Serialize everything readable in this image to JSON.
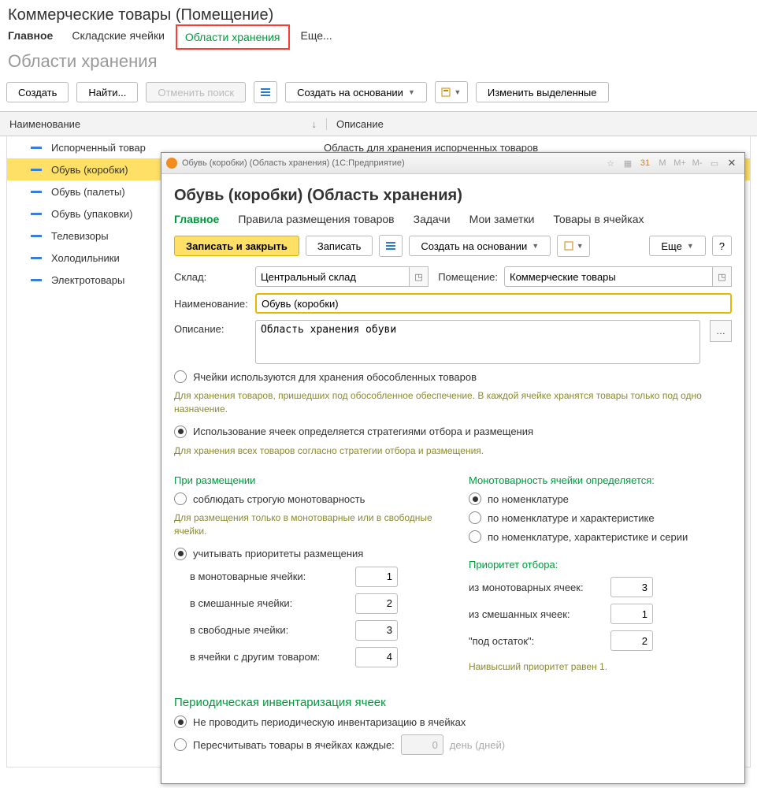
{
  "page": {
    "title": "Коммерческие товары (Помещение)",
    "subtitle": "Области хранения",
    "tabs": [
      "Главное",
      "Складские ячейки",
      "Области хранения",
      "Еще..."
    ],
    "toolbar": {
      "create": "Создать",
      "find": "Найти...",
      "cancel_search": "Отменить поиск",
      "create_based": "Создать на основании",
      "change_selected": "Изменить выделенные"
    },
    "columns": {
      "name": "Наименование",
      "desc": "Описание"
    },
    "rows": [
      {
        "name": "Испорченный товар",
        "desc": "Область для хранения испорченных товаров"
      },
      {
        "name": "Обувь (коробки)",
        "desc": ""
      },
      {
        "name": "Обувь (палеты)",
        "desc": ""
      },
      {
        "name": "Обувь (упаковки)",
        "desc": ""
      },
      {
        "name": "Телевизоры",
        "desc": ""
      },
      {
        "name": "Холодильники",
        "desc": ""
      },
      {
        "name": "Электротовары",
        "desc": ""
      }
    ]
  },
  "dialog": {
    "window_title": "Обувь (коробки) (Область хранения)  (1С:Предприятие)",
    "title_buttons": [
      "M",
      "M+",
      "M-"
    ],
    "h1": "Обувь (коробки) (Область хранения)",
    "tabs": [
      "Главное",
      "Правила размещения товаров",
      "Задачи",
      "Мои заметки",
      "Товары в ячейках"
    ],
    "toolbar": {
      "save_close": "Записать и закрыть",
      "save": "Записать",
      "create_based": "Создать на основании",
      "more": "Еще",
      "help": "?"
    },
    "fields": {
      "warehouse_label": "Склад:",
      "warehouse_value": "Центральный склад",
      "room_label": "Помещение:",
      "room_value": "Коммерческие товары",
      "name_label": "Наименование:",
      "name_value": "Обувь (коробки)",
      "desc_label": "Описание:",
      "desc_value": "Область хранения обуви"
    },
    "radio1": {
      "opt1": "Ячейки используются для хранения обособленных товаров",
      "note1": "Для хранения товаров, пришедших под обособленное обеспечение. В каждой ячейке хранятся товары только под одно назначение.",
      "opt2": "Использование ячеек определяется стратегиями отбора и размещения",
      "note2": "Для хранения всех товаров согласно стратегии отбора и размещения."
    },
    "placement": {
      "head": "При размещении",
      "opt1": "соблюдать строгую монотоварность",
      "note": "Для размещения только в монотоварные или в свободные ячейки.",
      "opt2": "учитывать приоритеты размещения",
      "rows": [
        {
          "label": "в монотоварные ячейки:",
          "value": "1"
        },
        {
          "label": "в смешанные ячейки:",
          "value": "2"
        },
        {
          "label": "в свободные ячейки:",
          "value": "3"
        },
        {
          "label": "в ячейки с другим товаром:",
          "value": "4"
        }
      ]
    },
    "mono": {
      "head": "Монотоварность ячейки определяется:",
      "opt1": "по номенклатуре",
      "opt2": "по номенклатуре и характеристике",
      "opt3": "по номенклатуре, характеристике и серии"
    },
    "pick": {
      "head": "Приоритет отбора:",
      "rows": [
        {
          "label": "из монотоварных ячеек:",
          "value": "3"
        },
        {
          "label": "из смешанных ячеек:",
          "value": "1"
        },
        {
          "label": "\"под остаток\":",
          "value": "2"
        }
      ],
      "note": "Наивысший приоритет равен 1."
    },
    "inventory": {
      "head": "Периодическая инвентаризация ячеек",
      "opt1": "Не проводить периодическую инвентаризацию в ячейках",
      "opt2": "Пересчитывать товары в ячейках каждые:",
      "days_value": "0",
      "days_suffix": "день (дней)"
    }
  }
}
